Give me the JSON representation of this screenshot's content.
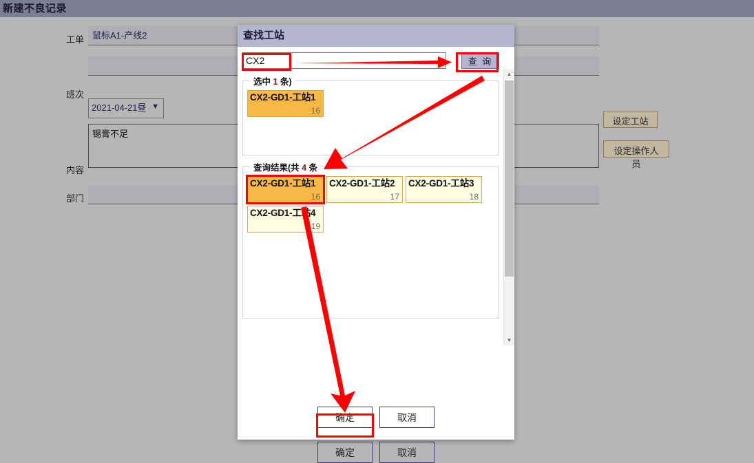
{
  "page": {
    "title": "新建不良记录"
  },
  "form": {
    "fields": [
      {
        "label": "工单",
        "value": "鼠标A1-产线2",
        "type": "text"
      },
      {
        "label": "班次",
        "value": "2021-04-21昼",
        "type": "select"
      },
      {
        "label": "内容",
        "value": "锡膏不足",
        "type": "textarea"
      },
      {
        "label": "部门",
        "value": "",
        "type": "text"
      }
    ],
    "side_buttons": [
      {
        "label": "设定工站"
      },
      {
        "label": "设定操作人员"
      }
    ],
    "footer_buttons": [
      {
        "label": "确定"
      },
      {
        "label": "取消"
      }
    ]
  },
  "dialog": {
    "title": "查找工站",
    "search": {
      "value": "CX2",
      "placeholder": "",
      "button_label": "查 询"
    },
    "selected_group": {
      "legend_prefix": "选中",
      "legend_count": "1",
      "legend_suffix": "条)",
      "items": [
        {
          "name": "CX2-GD1-工站1",
          "id": "16",
          "selected": true
        }
      ]
    },
    "results_group": {
      "legend_prefix": "查询结果(共",
      "legend_count": "4",
      "legend_suffix": "条",
      "items": [
        {
          "name": "CX2-GD1-工站1",
          "id": "16",
          "selected": true
        },
        {
          "name": "CX2-GD1-工站2",
          "id": "17",
          "selected": false
        },
        {
          "name": "CX2-GD1-工站3",
          "id": "18",
          "selected": false
        },
        {
          "name": "CX2-GD1-工站4",
          "id": "19",
          "selected": false
        }
      ]
    },
    "footer_buttons": [
      {
        "label": "确定"
      },
      {
        "label": "取消"
      }
    ],
    "scrollbar": {
      "up_arrow": "▲",
      "down_arrow": "▼"
    }
  },
  "annotations": {
    "color": "#ff0000",
    "arrows": [
      {
        "name": "arrow-to-search-button"
      },
      {
        "name": "arrow-to-results-legend"
      },
      {
        "name": "arrow-to-confirm-button"
      }
    ]
  }
}
